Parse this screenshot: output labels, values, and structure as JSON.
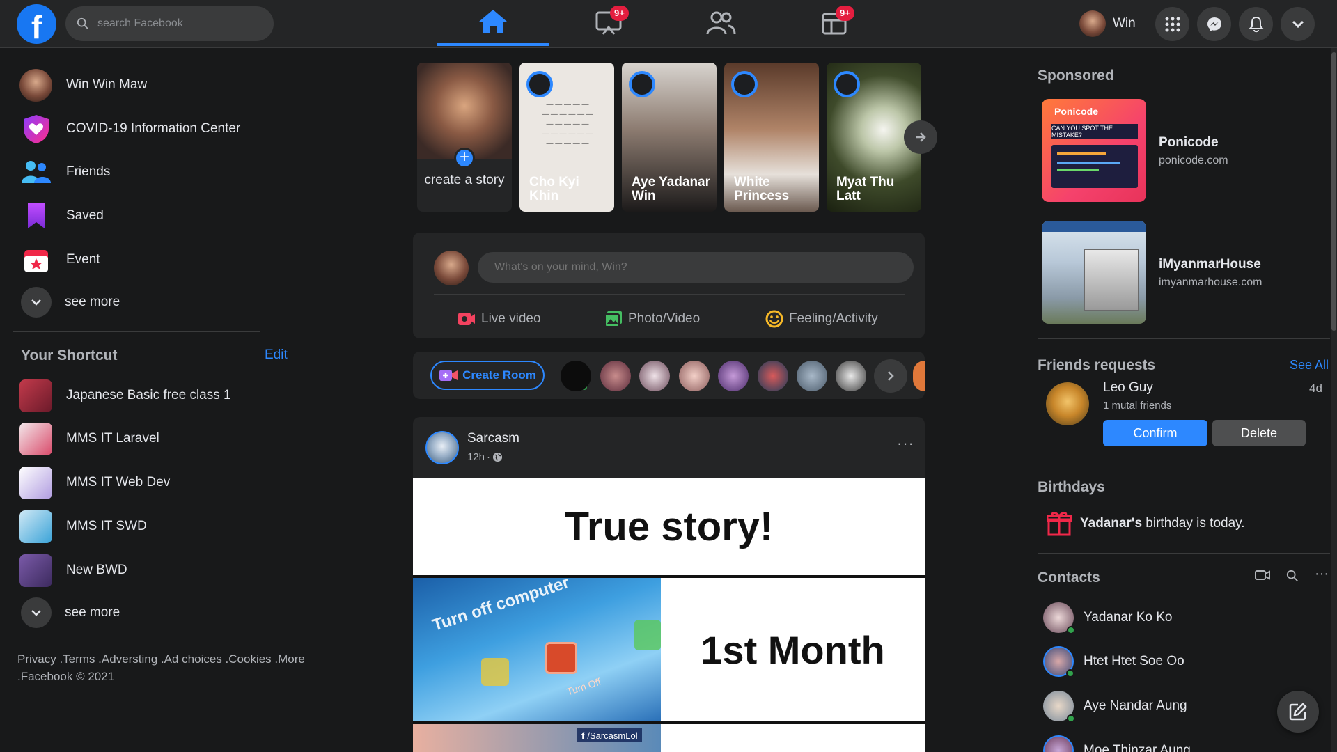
{
  "header": {
    "search_placeholder": "search Facebook",
    "watch_badge": "9+",
    "gaming_badge": "9+",
    "profile_name": "Win"
  },
  "left_nav": {
    "items": [
      {
        "label": "Win Win Maw",
        "icon": "profile-avatar"
      },
      {
        "label": "COVID-19 Information Center",
        "icon": "covid-shield-icon"
      },
      {
        "label": "Friends",
        "icon": "friends-icon"
      },
      {
        "label": "Saved",
        "icon": "saved-bookmark-icon"
      },
      {
        "label": "Event",
        "icon": "event-calendar-icon"
      }
    ],
    "see_more": "see more"
  },
  "shortcuts": {
    "title": "Your Shortcut",
    "edit": "Edit",
    "items": [
      {
        "label": "Japanese Basic free class 1"
      },
      {
        "label": "MMS IT Laravel"
      },
      {
        "label": "MMS IT Web Dev"
      },
      {
        "label": "MMS IT SWD"
      },
      {
        "label": "New BWD"
      }
    ],
    "see_more": "see more"
  },
  "footer": {
    "text": "Privacy .Terms .Adversting .Ad choices .Cookies .More .Facebook © 2021"
  },
  "stories": {
    "create_label": "create a story",
    "items": [
      {
        "name": "Cho Kyi Khin"
      },
      {
        "name": "Aye Yadanar Win"
      },
      {
        "name": "White Princess"
      },
      {
        "name": "Myat Thu Latt"
      }
    ]
  },
  "composer": {
    "placeholder": "What's on your mind, Win?",
    "live_video": "Live video",
    "photo_video": "Photo/Video",
    "feeling": "Feeling/Activity"
  },
  "rooms": {
    "create_room": "Create Room"
  },
  "post": {
    "author": "Sarcasm",
    "time": "12h",
    "image_title": "True story!",
    "panel_label": "1st Month",
    "screen_text": "Turn off computer",
    "button_text": "Turn Off",
    "watermark": "/SarcasmLol"
  },
  "sponsored": {
    "title": "Sponsored",
    "ads": [
      {
        "name": "Ponicode",
        "domain": "ponicode.com",
        "badge": "Ponicode",
        "caption": "CAN YOU SPOT THE MISTAKE?"
      },
      {
        "name": "iMyanmarHouse",
        "domain": "imyanmarhouse.com"
      }
    ]
  },
  "friend_requests": {
    "title": "Friends requests",
    "see_all": "See All",
    "name": "Leo Guy",
    "mutual": "1 mutal friends",
    "age": "4d",
    "confirm": "Confirm",
    "delete": "Delete"
  },
  "birthdays": {
    "title": "Birthdays",
    "name": "Yadanar's",
    "text": " birthday is today."
  },
  "contacts": {
    "title": "Contacts",
    "items": [
      {
        "name": "Yadanar Ko Ko"
      },
      {
        "name": "Htet Htet Soe Oo"
      },
      {
        "name": "Aye Nandar Aung"
      },
      {
        "name": "Moe Thinzar Aung"
      }
    ]
  }
}
